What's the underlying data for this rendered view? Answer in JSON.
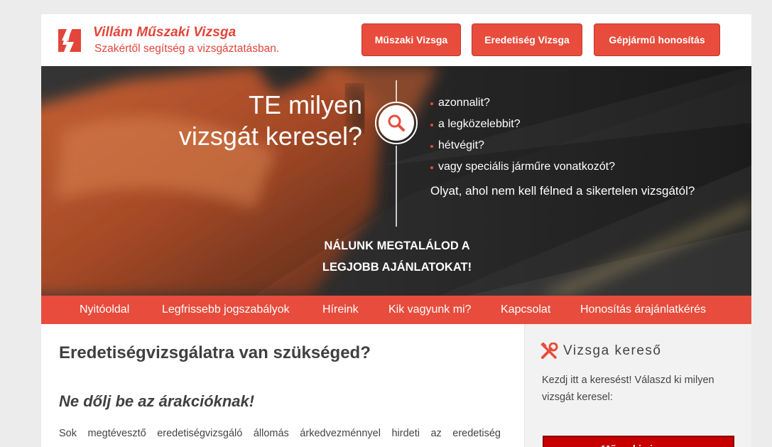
{
  "brand": {
    "title": "Villám Műszaki Vizsga",
    "tagline": "Szakértől segítség a vizsgáztatásban.",
    "accent": "#e74c3c"
  },
  "top_buttons": [
    {
      "label": "Műszaki Vizsga"
    },
    {
      "label": "Eredetiség Vizsga"
    },
    {
      "label": "Gépjármű honosítás"
    }
  ],
  "hero": {
    "title_line1": "TE milyen",
    "title_line2": "vizsgát keresel?",
    "bullets": [
      "azonnalit?",
      "a legközelebbit?",
      "hétvégit?",
      "vagy speciális járműre vonatkozót?"
    ],
    "question": "Olyat, ahol nem kell félned a sikertelen vizsgától?",
    "cta_line1": "NÁLUNK MEGTALÁLOD A",
    "cta_line2": "LEGJOBB AJÁNLATOKAT!",
    "icon": "search-icon"
  },
  "nav": [
    {
      "label": "Nyitóoldal"
    },
    {
      "label": "Legfrissebb jogszabályok"
    },
    {
      "label": "Híreink"
    },
    {
      "label": "Kik vagyunk mi?"
    },
    {
      "label": "Kapcsolat"
    },
    {
      "label": "Honosítás árajánlatkérés"
    }
  ],
  "main": {
    "heading": "Eredetiségvizsgálatra van szükséged?",
    "subheading": "Ne dőlj be az árakcióknak!",
    "paragraph": "Sok megtévesztő eredetiségvizsgáló állomás árkedvezménnyel hirdeti az eredetiség"
  },
  "sidebar": {
    "title": "Vizsga kereső",
    "icon": "tools-icon",
    "text": "Kezdj itt a keresést! Válaszd ki milyen vizsgát keresel:",
    "button": "Műszaki vizsga"
  }
}
